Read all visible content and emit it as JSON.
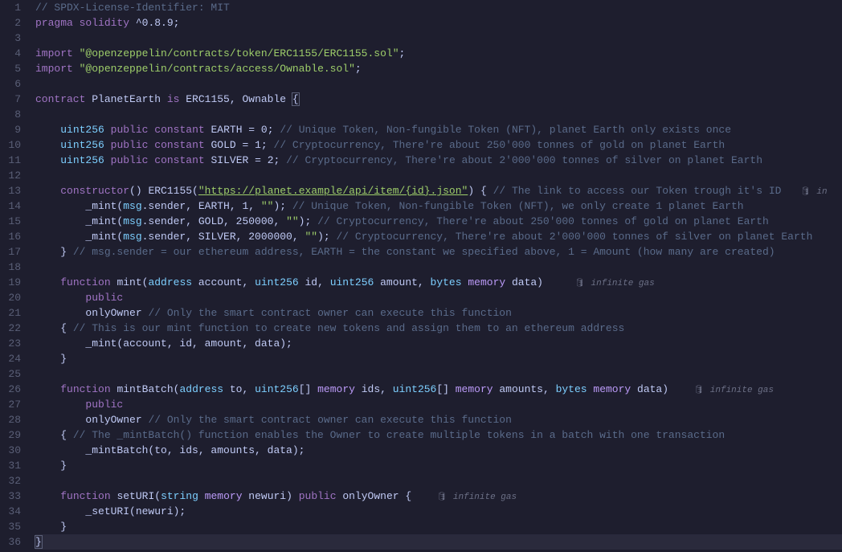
{
  "gas_hints": {
    "l13": "in",
    "l19": "infinite gas",
    "l26": "infinite gas",
    "l33": "infinite gas"
  },
  "lines": {
    "l1": {
      "c1": "// SPDX-License-Identifier: MIT"
    },
    "l2": {
      "k1": "pragma",
      "k2": "solidity",
      "v": " ^0.8.9;"
    },
    "l3": {},
    "l4": {
      "k": "import",
      "s": "\"@openzeppelin/contracts/token/ERC1155/ERC1155.sol\"",
      "e": ";"
    },
    "l5": {
      "k": "import",
      "s": "\"@openzeppelin/contracts/access/Ownable.sol\"",
      "e": ";"
    },
    "l6": {},
    "l7": {
      "k1": "contract",
      "n": " PlanetEarth ",
      "k2": "is",
      "r": " ERC1155, Ownable ",
      "b": "{"
    },
    "l8": {},
    "l9": {
      "t": "uint256",
      "k1": "public",
      "k2": "constant",
      "n": " EARTH = 0; ",
      "c": "// Unique Token, Non-fungible Token (NFT), planet Earth only exists once"
    },
    "l10": {
      "t": "uint256",
      "k1": "public",
      "k2": "constant",
      "n": " GOLD = 1; ",
      "c": "// Cryptocurrency, There're about 250'000 tonnes of gold on planet Earth"
    },
    "l11": {
      "t": "uint256",
      "k1": "public",
      "k2": "constant",
      "n": " SILVER = 2; ",
      "c": "// Cryptocurrency, There're about 2'000'000 tonnes of silver on planet Earth"
    },
    "l12": {},
    "l13": {
      "k": "constructor",
      "p": "() ERC1155(",
      "s": "\"https://planet.example/api/item/{id}.json\"",
      "p2": ") { ",
      "c": "// The link to access our Token trough it's ID"
    },
    "l14": {
      "pre": "        _mint(",
      "m": "msg",
      "mid": ".sender, EARTH, 1, ",
      "s": "\"\"",
      "p2": "); ",
      "c": "// Unique Token, Non-fungible Token (NFT), we only create 1 planet Earth"
    },
    "l15": {
      "pre": "        _mint(",
      "m": "msg",
      "mid": ".sender, GOLD, 250000, ",
      "s": "\"\"",
      "p2": "); ",
      "c": "// Cryptocurrency, There're about 250'000 tonnes of gold on planet Earth"
    },
    "l16": {
      "pre": "        _mint(",
      "m": "msg",
      "mid": ".sender, SILVER, 2000000, ",
      "s": "\"\"",
      "p2": "); ",
      "c": "// Cryptocurrency, There're about 2'000'000 tonnes of silver on planet Earth"
    },
    "l17": {
      "b": "    } ",
      "c": "// msg.sender = our ethereum address, EARTH = the constant we specified above, 1 = Amount (how many are created)"
    },
    "l18": {},
    "l19": {
      "k": "function",
      "n": " mint(",
      "t1": "address",
      "a1": " account, ",
      "t2": "uint256",
      "a2": " id, ",
      "t3": "uint256",
      "a3": " amount, ",
      "t4": "bytes",
      "m": "memory",
      "a4": " data)"
    },
    "l20": {
      "k": "public"
    },
    "l21": {
      "n": "        onlyOwner ",
      "c": "// Only the smart contract owner can execute this function"
    },
    "l22": {
      "b": "    { ",
      "c": "// This is our mint function to create new tokens and assign them to an ethereum address"
    },
    "l23": {
      "t": "        _mint(account, id, amount, data);"
    },
    "l24": {
      "t": "    }"
    },
    "l25": {},
    "l26": {
      "k": "function",
      "n": " mintBatch(",
      "t1": "address",
      "a1": " to, ",
      "t2": "uint256",
      "br1": "[] ",
      "m1": "memory",
      "a2": " ids, ",
      "t3": "uint256",
      "br2": "[] ",
      "m2": "memory",
      "a3": " amounts, ",
      "t4": "bytes",
      "m3": "memory",
      "a4": " data)"
    },
    "l27": {
      "k": "public"
    },
    "l28": {
      "n": "        onlyOwner ",
      "c": "// Only the smart contract owner can execute this function"
    },
    "l29": {
      "b": "    { ",
      "c": "// The _mintBatch() function enables the Owner to create multiple tokens in a batch with one transaction"
    },
    "l30": {
      "t": "        _mintBatch(to, ids, amounts, data);"
    },
    "l31": {
      "t": "    }"
    },
    "l32": {},
    "l33": {
      "k": "function",
      "n": " setURI(",
      "t1": "string",
      "m": "memory",
      "a1": " newuri) ",
      "k2": "public",
      "a2": " onlyOwner {"
    },
    "l34": {
      "t": "        _setURI(newuri);"
    },
    "l35": {
      "t": "    }"
    },
    "l36": {
      "t": "}"
    }
  }
}
